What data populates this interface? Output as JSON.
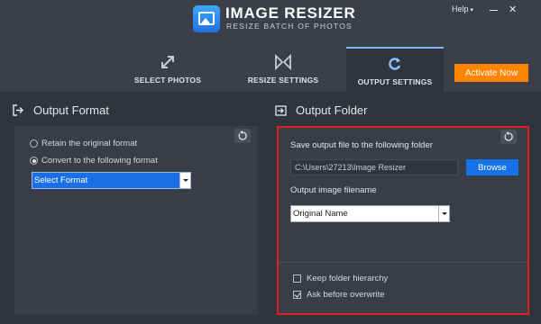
{
  "app": {
    "title": "IMAGE RESIZER",
    "subtitle": "RESIZE BATCH OF PHOTOS",
    "logo_icon": "image-resizer-logo-icon"
  },
  "window_controls": {
    "help_label": "Help",
    "help_caret": "▾",
    "close_glyph": "✕"
  },
  "tabs": [
    {
      "label": "SELECT PHOTOS",
      "icon": "expand-arrows-icon",
      "active": false
    },
    {
      "label": "RESIZE SETTINGS",
      "icon": "resize-arrows-icon",
      "active": false
    },
    {
      "label": "OUTPUT SETTINGS",
      "icon": "refresh-icon",
      "active": true
    }
  ],
  "activate_button": {
    "label": "Activate Now",
    "color": "#ff8400"
  },
  "output_format": {
    "title": "Output Format",
    "icon": "export-icon",
    "options": [
      {
        "label": "Retain the original format",
        "checked": false
      },
      {
        "label": "Convert to the following format",
        "checked": true
      }
    ],
    "select": {
      "value": "Select Format"
    }
  },
  "output_folder": {
    "title": "Output Folder",
    "icon": "folder-icon",
    "save_label": "Save output file to the following folder",
    "path_value": "C:\\Users\\27213\\Image Resizer",
    "browse_label": "Browse",
    "filename_label": "Output image filename",
    "filename_select": {
      "value": "Original Name"
    },
    "checkboxes": [
      {
        "label": "Keep folder hierarchy",
        "checked": false
      },
      {
        "label": "Ask before overwrite",
        "checked": true
      }
    ]
  },
  "colors": {
    "accent_blue": "#1672e8",
    "highlight_border": "#e01e1e",
    "background": "#2f343d"
  }
}
